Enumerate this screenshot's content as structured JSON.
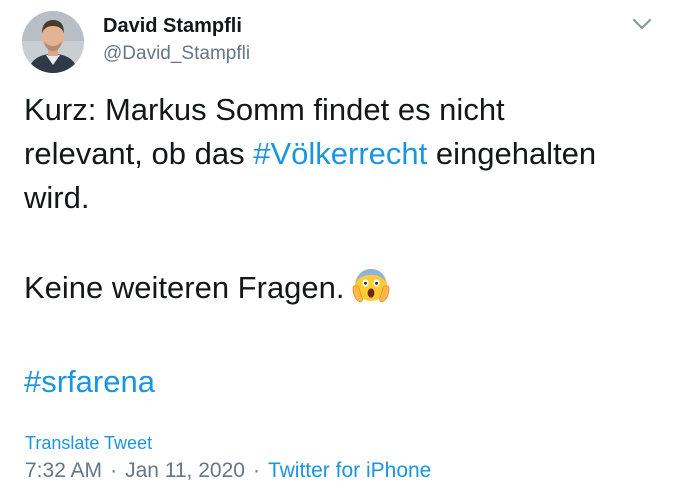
{
  "tweet": {
    "author": {
      "name": "David Stampfli",
      "handle": "@David_Stampfli"
    },
    "body": {
      "line1": "Kurz: Markus Somm findet es nicht",
      "line2_pre": "relevant, ob das ",
      "line2_hashtag": "#Völkerrecht",
      "line2_post": " eingehalten",
      "line3": "wird.",
      "line4": "Keine weiteren Fragen.",
      "line5_hashtag": "#srfarena"
    },
    "translate_label": "Translate Tweet",
    "time": "7:32 AM",
    "date": "Jan 11, 2020",
    "separator": "·",
    "source": "Twitter for iPhone",
    "colors": {
      "link": "#1b95e0",
      "secondary": "#657786",
      "text": "#14171a"
    },
    "icons": {
      "menu": "chevron-down-icon",
      "emoji": "face-screaming-in-fear-emoji"
    }
  }
}
